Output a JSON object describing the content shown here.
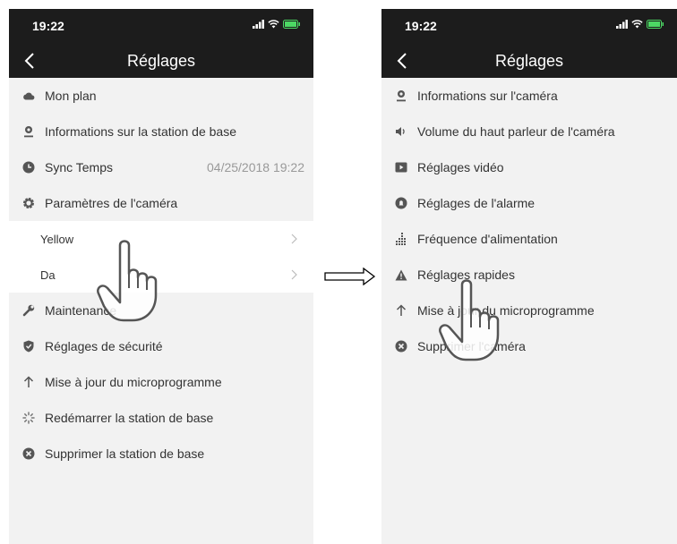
{
  "left": {
    "status": {
      "time": "19:22"
    },
    "nav": {
      "title": "Réglages"
    },
    "items": [
      {
        "label": "Mon plan",
        "icon": "cloud-icon"
      },
      {
        "label": "Informations sur la station de base",
        "icon": "location-pin-icon"
      },
      {
        "label": "Sync Temps",
        "icon": "clock-icon",
        "value": "04/25/2018 19:22"
      },
      {
        "label": "Paramètres de l'caméra",
        "icon": "gear-icon"
      }
    ],
    "sub_items": [
      {
        "label": "Yellow"
      },
      {
        "label": "Da"
      }
    ],
    "items_after": [
      {
        "label": "Maintenance",
        "icon": "wrench-icon"
      },
      {
        "label": "Réglages de sécurité",
        "icon": "shield-icon"
      },
      {
        "label": "Mise à jour du microprogramme",
        "icon": "arrow-up-icon"
      },
      {
        "label": "Redémarrer la station de base",
        "icon": "spinner-icon"
      },
      {
        "label": "Supprimer la station de base",
        "icon": "delete-circle-icon"
      }
    ]
  },
  "right": {
    "status": {
      "time": "19:22"
    },
    "nav": {
      "title": "Réglages"
    },
    "items": [
      {
        "label": "Informations sur l'caméra",
        "icon": "location-pin-icon"
      },
      {
        "label": "Volume du haut parleur de l'caméra",
        "icon": "speaker-icon"
      },
      {
        "label": "Réglages vidéo",
        "icon": "video-icon"
      },
      {
        "label": "Réglages de l'alarme",
        "icon": "alarm-icon"
      },
      {
        "label": "Fréquence d'alimentation",
        "icon": "frequency-bars-icon"
      },
      {
        "label": "Réglages rapides",
        "icon": "warning-triangle-icon"
      },
      {
        "label": "Mise à jour du microprogramme",
        "icon": "arrow-up-icon"
      },
      {
        "label": "Supprimer l'caméra",
        "icon": "delete-circle-icon"
      }
    ]
  },
  "colors": {
    "bar": "#1c1c1c",
    "list_bg": "#f2f2f2",
    "icon": "#555555",
    "battery": "#4cd964"
  }
}
